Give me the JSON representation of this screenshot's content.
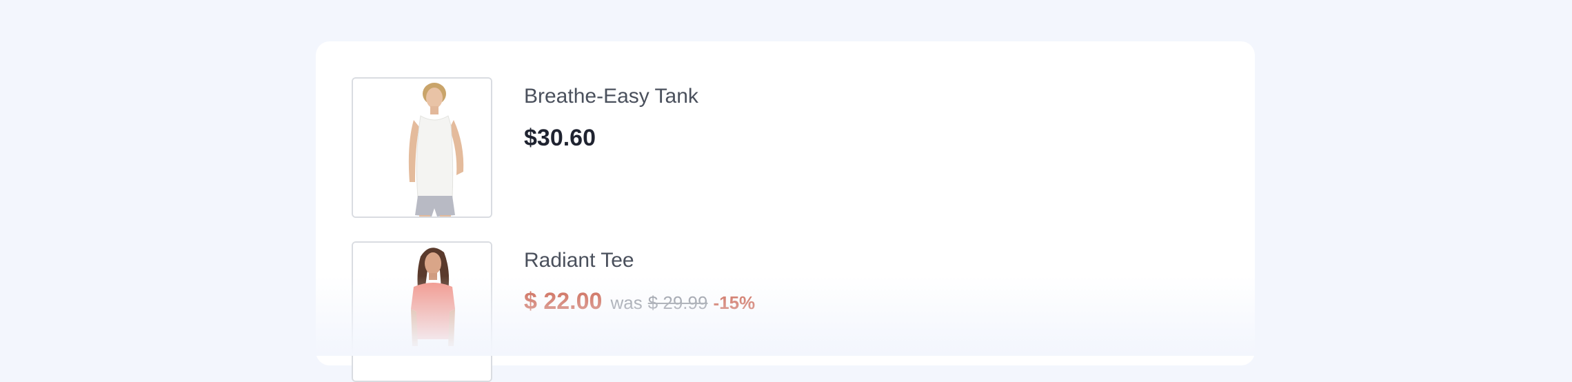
{
  "products": [
    {
      "name": "Breathe-Easy Tank",
      "price": "$30.60",
      "image": "woman-white-tank-top-photo"
    },
    {
      "name": "Radiant Tee",
      "sale_price": "$ 22.00",
      "was_label": "was",
      "old_price": "$ 29.99",
      "discount": "-15%",
      "image": "woman-pink-tee-photo"
    }
  ],
  "colors": {
    "background": "#f3f6fd",
    "card": "#ffffff",
    "price": "#1f2330",
    "sale": "#c8553f",
    "muted": "#8a8e96"
  }
}
